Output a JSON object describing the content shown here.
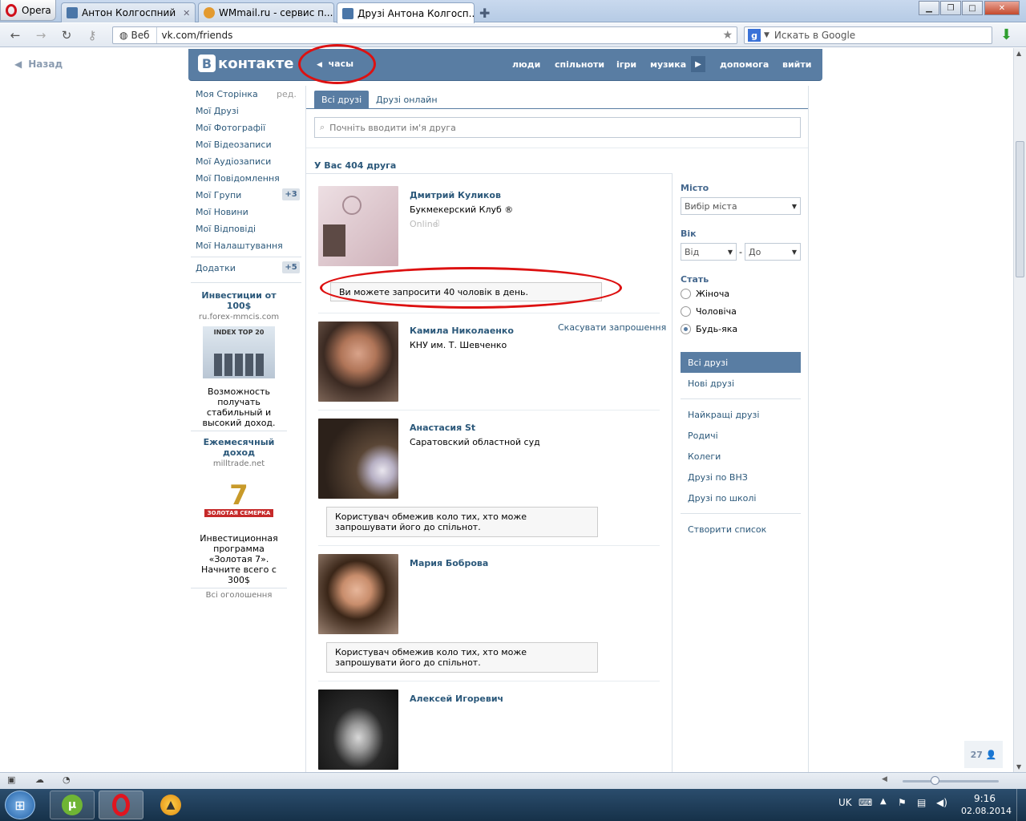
{
  "browser": {
    "menu_label": "Opera",
    "tabs": [
      {
        "title": "Антон Колгоспний"
      },
      {
        "title": "WMmail.ru - сервис п..."
      },
      {
        "title": "Друзі Антона Колгосп..."
      }
    ],
    "address": {
      "scheme_label": "Веб",
      "url": "vk.com/friends"
    },
    "search_placeholder": "Искать в Google"
  },
  "page": {
    "back_label": "Назад",
    "header": {
      "logo_letter": "В",
      "logo_text": "контакте",
      "player_label": "часы",
      "nav": [
        "люди",
        "спільноти",
        "ігри",
        "музика",
        "допомога",
        "вийти"
      ]
    },
    "left_menu": {
      "items": [
        "Моя Сторінка",
        "Мої Друзі",
        "Мої Фотографії",
        "Мої Відеозаписи",
        "Мої Аудіозаписи",
        "Мої Повідомлення",
        "Мої Групи",
        "Мої Новини",
        "Мої Відповіді",
        "Мої Налаштування"
      ],
      "edit_label": "ред.",
      "groups_badge": "+3",
      "apps_label": "Додатки",
      "apps_badge": "+5"
    },
    "ads": [
      {
        "title": "Инвестиции от 100$",
        "domain": "ru.forex-mmcis.com",
        "logo_text": "INDEX TOP 20",
        "text": "Возможность получать стабильный и высокий доход."
      },
      {
        "title": "Ежемесячный доход",
        "domain": "milltrade.net",
        "logo_text": "ЗОЛОТАЯ СЕМЕРКА",
        "logo_number": "7",
        "text": "Инвестиционная программа «Золотая 7». Начните всего с 300$"
      }
    ],
    "ads_all_label": "Всі оголошення",
    "friends": {
      "tabs": [
        "Всі друзі",
        "Друзі онлайн"
      ],
      "search_placeholder": "Почніть вводити ім'я друга",
      "count_label": "У Вас 404 друга",
      "list": [
        {
          "name": "Дмитрий Куликов",
          "sub": "Букмекерский Клуб ®",
          "status": "Online",
          "notice": "Ви можете запросити 40 чоловік в день.",
          "photo": "#d9c2c9"
        },
        {
          "name": "Камила Николаенко",
          "sub": "КНУ им. Т. Шевченко",
          "action": "Скасувати запрошення",
          "photo": "#8a6a55"
        },
        {
          "name": "Анастасия St",
          "sub": "Саратовский областной суд",
          "notice": "Користувач обмежив коло тих, хто може запрошувати його до спільнот.",
          "photo": "#4b3a2c"
        },
        {
          "name": "Мария Боброва",
          "sub": "",
          "notice": "Користувач обмежив коло тих, хто може запрошувати його до спільнот.",
          "photo": "#6b4a33"
        },
        {
          "name": "Алексей Игоревич",
          "sub": "",
          "photo": "#2d2d2d"
        }
      ]
    },
    "filters": {
      "city_label": "Місто",
      "city_value": "Вибір міста",
      "age_label": "Вік",
      "age_from": "Від",
      "age_to": "До",
      "gender_label": "Стать",
      "gender_options": [
        "Жіноча",
        "Чоловіча",
        "Будь-яка"
      ],
      "gender_selected": "Будь-яка",
      "lists_selected": "Всі друзі",
      "lists": [
        "Нові друзі",
        "Найкращі друзі",
        "Родичі",
        "Колеги",
        "Друзі по ВНЗ",
        "Друзі по школі"
      ],
      "create_list": "Створити список"
    },
    "online_counter": "27"
  },
  "taskbar": {
    "lang": "UK",
    "time": "9:16",
    "date": "02.08.2014"
  },
  "colors": {
    "vk_blue": "#597da3",
    "link": "#2b587a",
    "annotation_red": "#dd1111"
  }
}
